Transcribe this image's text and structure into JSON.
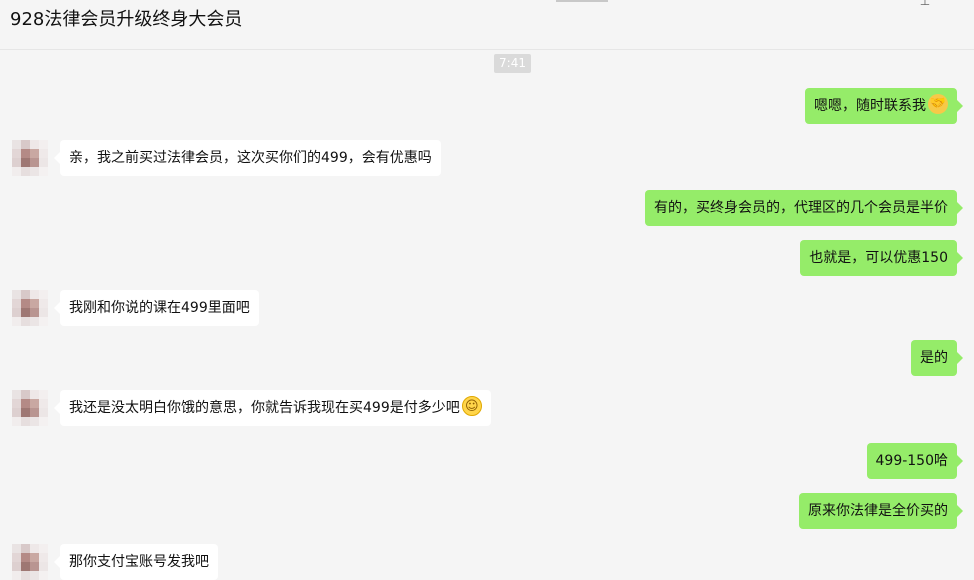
{
  "window": {
    "title": "928法律会员升级终身大会员",
    "pin_icon": "pin-icon"
  },
  "timestamp": "7:41",
  "messages": [
    {
      "dir": "out",
      "text": "嗯嗯，随时联系我",
      "emoji": "handshake-emoji"
    },
    {
      "dir": "in",
      "text": "亲，我之前买过法律会员，这次买你们的499，会有优惠吗"
    },
    {
      "dir": "out",
      "text": "有的，买终身会员的，代理区的几个会员是半价"
    },
    {
      "dir": "out",
      "text": "也就是，可以优惠150"
    },
    {
      "dir": "in",
      "text": "我刚和你说的课在499里面吧"
    },
    {
      "dir": "out",
      "text": "是的"
    },
    {
      "dir": "in",
      "text": "我还是没太明白你饿的意思，你就告诉我现在买499是付多少吧",
      "emoji": "smile-emoji"
    },
    {
      "dir": "out",
      "text": "499-150哈"
    },
    {
      "dir": "out",
      "text": "原来你法律是全价买的"
    },
    {
      "dir": "in",
      "text": "那你支付宝账号发我吧"
    }
  ],
  "colors": {
    "outgoing_bubble": "#95ec69",
    "incoming_bubble": "#ffffff",
    "background": "#f5f5f5",
    "timestamp_bg": "#dadada"
  }
}
